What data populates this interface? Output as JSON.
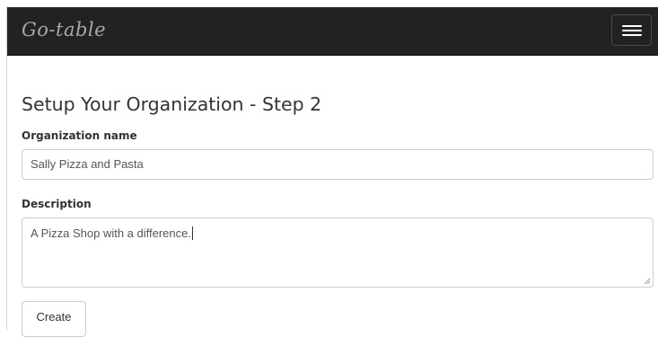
{
  "navbar": {
    "brand": "Go-table",
    "menu_icon": "hamburger-menu-icon"
  },
  "form": {
    "title": "Setup Your Organization - Step 2",
    "org_name_label": "Organization name",
    "org_name_value": "Sally Pizza and Pasta",
    "description_label": "Description",
    "description_value": "A Pizza Shop with a difference.",
    "create_label": "Create"
  },
  "colors": {
    "navbar_bg": "#222222",
    "brand_text": "#a9a9a9",
    "input_border": "#cccccc",
    "text": "#333333"
  }
}
